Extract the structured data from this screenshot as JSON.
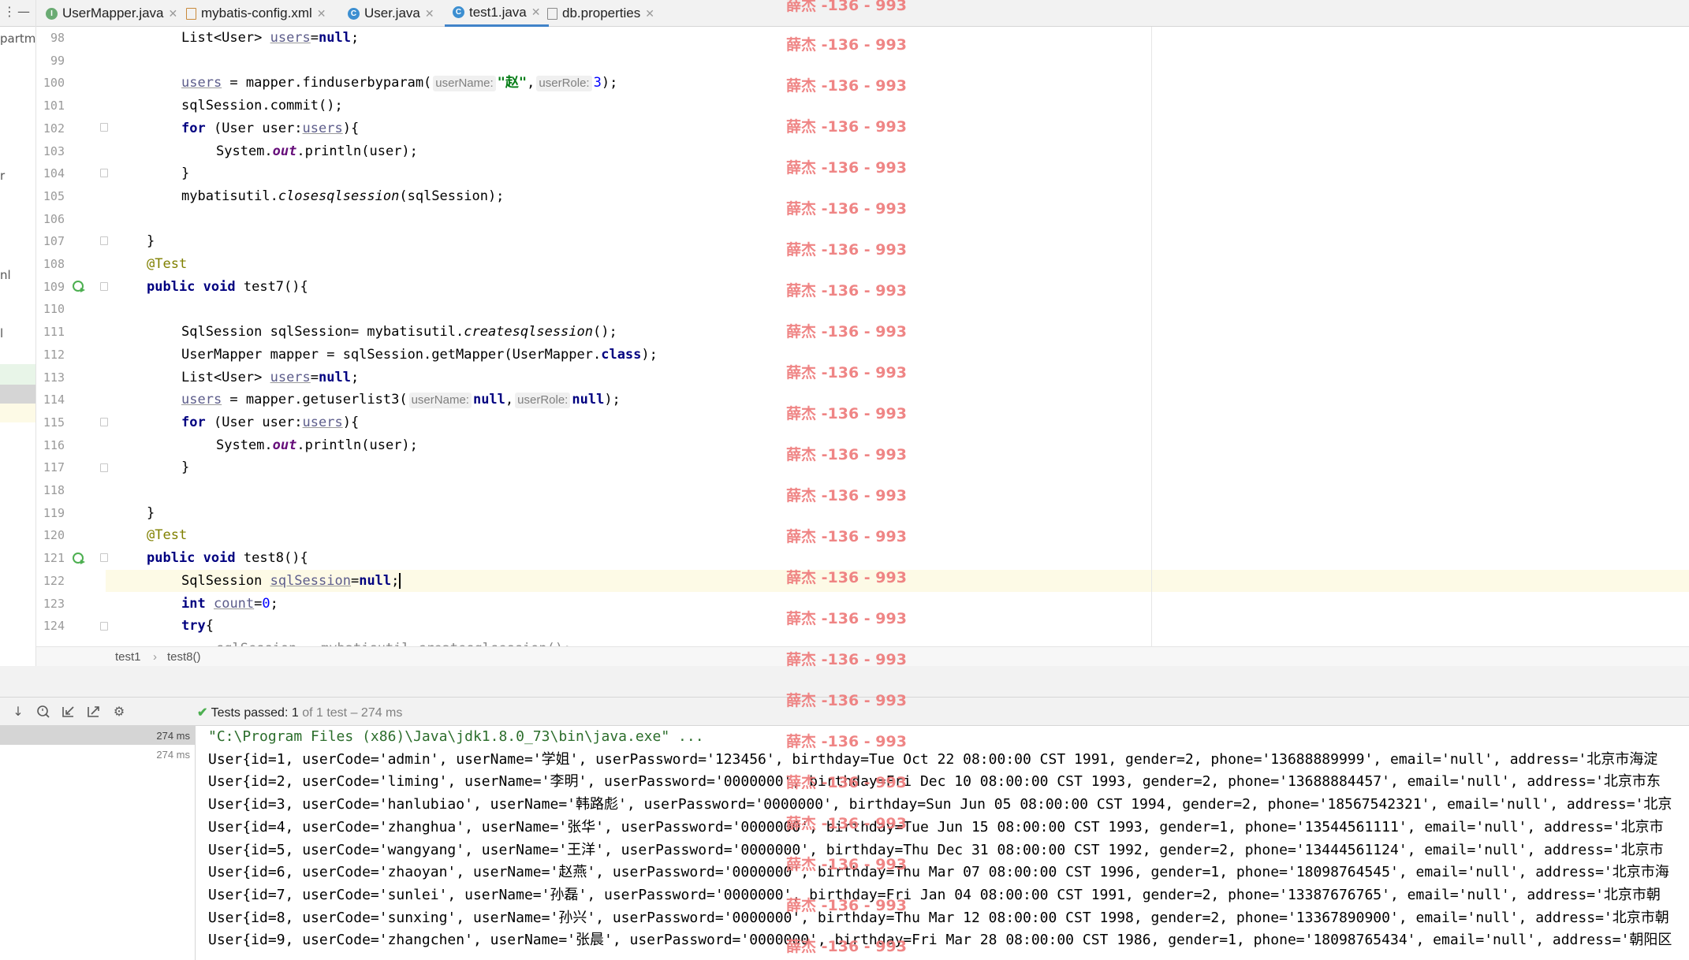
{
  "project_panel": {
    "fragments": [
      "partm",
      "r",
      "nl",
      "l"
    ]
  },
  "tabs": [
    {
      "label": "UserMapper.java",
      "icon": "interface-icon",
      "color": "#6aab73",
      "letter": "I"
    },
    {
      "label": "mybatis-config.xml",
      "icon": "xml-file-icon",
      "color": "#c98a3b",
      "letter": ""
    },
    {
      "label": "User.java",
      "icon": "class-icon",
      "color": "#3d8fd1",
      "letter": "C"
    },
    {
      "label": "test1.java",
      "icon": "class-icon",
      "color": "#3d8fd1",
      "letter": "C",
      "active": true
    },
    {
      "label": "db.properties",
      "icon": "properties-file-icon",
      "color": "#8a8a8a",
      "letter": ""
    }
  ],
  "editor": {
    "line_numbers": [
      "98",
      "99",
      "100",
      "101",
      "102",
      "103",
      "104",
      "105",
      "106",
      "107",
      "108",
      "109",
      "110",
      "111",
      "112",
      "113",
      "114",
      "115",
      "116",
      "117",
      "118",
      "119",
      "120",
      "121",
      "122",
      "123",
      "124"
    ],
    "code": {
      "l98_type": "List<User> ",
      "l98_var": "users",
      "l98_eq": "=",
      "l98_null": "null",
      "l98_end": ";",
      "l100_var": "users",
      "l100_mid": " = mapper.finduserbyparam(",
      "l100_hint1": "userName:",
      "l100_str": "\"赵\"",
      "l100_comma": ",",
      "l100_hint2": "userRole:",
      "l100_num": "3",
      "l100_end": ");",
      "l101": "sqlSession.commit();",
      "l102_kw": "for",
      "l102_a": " (User user:",
      "l102_var": "users",
      "l102_b": "){",
      "l103_a": "System.",
      "l103_out": "out",
      "l103_b": ".println(user);",
      "l104": "}",
      "l105_a": "mybatisutil.",
      "l105_m": "closesqlsession",
      "l105_b": "(sqlSession);",
      "l107": "}",
      "l108": "@Test",
      "l109_kw1": "public",
      "l109_kw2": "void",
      "l109_rest": " test7(){",
      "l111_a": "SqlSession sqlSession= mybatisutil.",
      "l111_m": "createsqlsession",
      "l111_b": "();",
      "l112_a": "UserMapper mapper = sqlSession.getMapper(UserMapper.",
      "l112_kw": "class",
      "l112_b": ");",
      "l113_type": "List<User> ",
      "l113_var": "users",
      "l113_eq": "=",
      "l113_null": "null",
      "l113_end": ";",
      "l114_var": "users",
      "l114_mid": " = mapper.getuserlist3(",
      "l114_hint1": "userName:",
      "l114_null1": "null",
      "l114_comma": ",",
      "l114_hint2": "userRole:",
      "l114_null2": "null",
      "l114_end": ");",
      "l115_kw": "for",
      "l115_a": " (User user:",
      "l115_var": "users",
      "l115_b": "){",
      "l116_a": "System.",
      "l116_out": "out",
      "l116_b": ".println(user);",
      "l117": "}",
      "l119": "}",
      "l120": "@Test",
      "l121_kw1": "public",
      "l121_kw2": "void",
      "l121_rest": " test8(){",
      "l122_a": "SqlSession ",
      "l122_var": "sqlSession",
      "l122_eq": "=",
      "l122_null": "null",
      "l122_end": ";",
      "l123_kw": "int",
      "l123_sp": " ",
      "l123_var": "count",
      "l123_eq": "=",
      "l123_num": "0",
      "l123_end": ";",
      "l124_kw": "try",
      "l124_b": "{",
      "l125": "sqlSession = mybatisutil.createsqlsession();"
    }
  },
  "breadcrumb": {
    "items": [
      "test1",
      "test8()"
    ]
  },
  "run": {
    "status": "Tests passed:",
    "count": "1",
    "detail": "of 1 test – 274 ms"
  },
  "tree": {
    "rows": [
      {
        "time": "274 ms",
        "selected": true
      },
      {
        "time": "274 ms",
        "selected": false
      }
    ]
  },
  "console": {
    "command": "\"C:\\Program Files (x86)\\Java\\jdk1.8.0_73\\bin\\java.exe\" ...",
    "lines": [
      "User{id=1, userCode='admin', userName='学姐', userPassword='123456', birthday=Tue Oct 22 08:00:00 CST 1991, gender=2, phone='13688889999', email='null', address='北京市海淀",
      "User{id=2, userCode='liming', userName='李明', userPassword='0000000', birthday=Fri Dec 10 08:00:00 CST 1993, gender=2, phone='13688884457', email='null', address='北京市东",
      "User{id=3, userCode='hanlubiao', userName='韩路彪', userPassword='0000000', birthday=Sun Jun 05 08:00:00 CST 1994, gender=2, phone='18567542321', email='null', address='北京",
      "User{id=4, userCode='zhanghua', userName='张华', userPassword='0000000', birthday=Tue Jun 15 08:00:00 CST 1993, gender=1, phone='13544561111', email='null', address='北京市",
      "User{id=5, userCode='wangyang', userName='王洋', userPassword='0000000', birthday=Thu Dec 31 08:00:00 CST 1992, gender=2, phone='13444561124', email='null', address='北京市",
      "User{id=6, userCode='zhaoyan', userName='赵燕', userPassword='0000000', birthday=Thu Mar 07 08:00:00 CST 1996, gender=1, phone='18098764545', email='null', address='北京市海",
      "User{id=7, userCode='sunlei', userName='孙磊', userPassword='0000000', birthday=Fri Jan 04 08:00:00 CST 1991, gender=2, phone='13387676765', email='null', address='北京市朝",
      "User{id=8, userCode='sunxing', userName='孙兴', userPassword='0000000', birthday=Thu Mar 12 08:00:00 CST 1998, gender=2, phone='13367890900', email='null', address='北京市朝",
      "User{id=9, userCode='zhangchen', userName='张晨', userPassword='0000000', birthday=Fri Mar 28 08:00:00 CST 1986, gender=1, phone='18098765434', email='null', address='朝阳区"
    ]
  },
  "watermark": {
    "text": "薛杰 -136 - 993"
  }
}
